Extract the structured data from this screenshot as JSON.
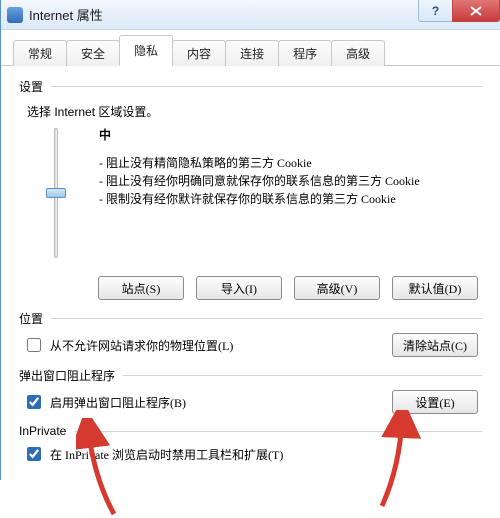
{
  "window": {
    "title": "Internet 属性"
  },
  "tabs": [
    {
      "label": "常规"
    },
    {
      "label": "安全"
    },
    {
      "label": "隐私"
    },
    {
      "label": "内容"
    },
    {
      "label": "连接"
    },
    {
      "label": "程序"
    },
    {
      "label": "高级"
    }
  ],
  "active_tab_index": 2,
  "settings": {
    "title": "设置",
    "zone_text": "选择 Internet 区域设置。",
    "level": "中",
    "desc": {
      "l1": "- 阻止没有精简隐私策略的第三方 Cookie",
      "l2": "- 阻止没有经你明确同意就保存你的联系信息的第三方 Cookie",
      "l3": "- 限制没有经你默许就保存你的联系信息的第三方 Cookie"
    },
    "buttons": {
      "sites": "站点(S)",
      "import": "导入(I)",
      "advanced": "高级(V)",
      "defaults": "默认值(D)"
    }
  },
  "location": {
    "title": "位置",
    "checkbox_label": "从不允许网站请求你的物理位置(L)",
    "checked": false,
    "clear_btn": "清除站点(C)"
  },
  "popup": {
    "title": "弹出窗口阻止程序",
    "checkbox_label": "启用弹出窗口阻止程序(B)",
    "checked": true,
    "settings_btn": "设置(E)"
  },
  "inprivate": {
    "title": "InPrivate",
    "checkbox_label": "在 InPrivate 浏览启动时禁用工具栏和扩展(T)",
    "checked": true
  }
}
